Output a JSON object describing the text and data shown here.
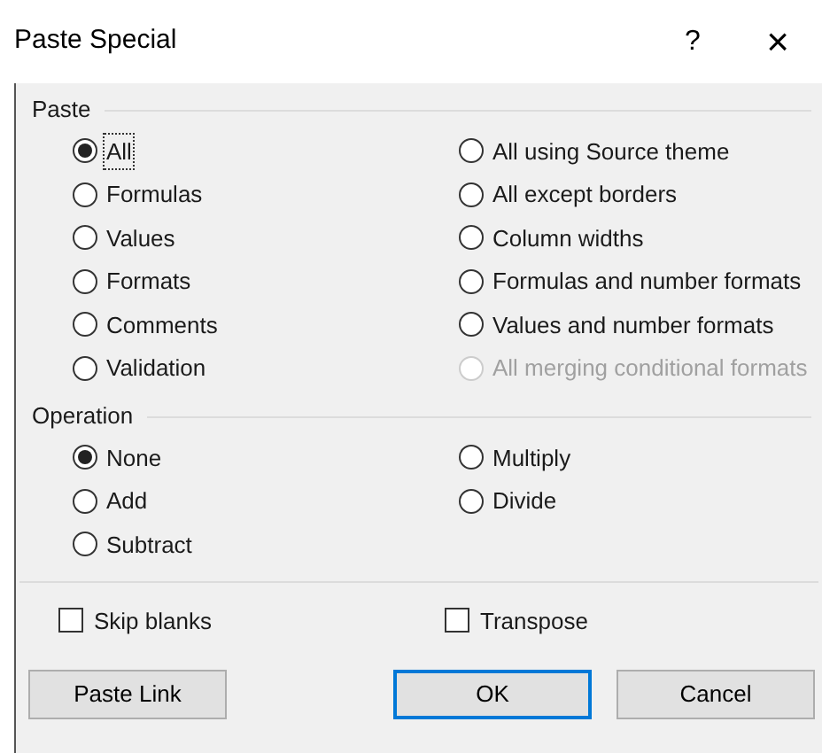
{
  "window": {
    "title": "Paste Special",
    "help": "?",
    "close": "×"
  },
  "paste": {
    "label": "Paste",
    "columns": [
      [
        {
          "label": "All",
          "selected": true,
          "disabled": false,
          "focused": true
        },
        {
          "label": "Formulas",
          "selected": false,
          "disabled": false,
          "focused": false
        },
        {
          "label": "Values",
          "selected": false,
          "disabled": false,
          "focused": false
        },
        {
          "label": "Formats",
          "selected": false,
          "disabled": false,
          "focused": false
        },
        {
          "label": "Comments",
          "selected": false,
          "disabled": false,
          "focused": false
        },
        {
          "label": "Validation",
          "selected": false,
          "disabled": false,
          "focused": false
        }
      ],
      [
        {
          "label": "All using Source theme",
          "selected": false,
          "disabled": false,
          "focused": false
        },
        {
          "label": "All except borders",
          "selected": false,
          "disabled": false,
          "focused": false
        },
        {
          "label": "Column widths",
          "selected": false,
          "disabled": false,
          "focused": false
        },
        {
          "label": "Formulas and number formats",
          "selected": false,
          "disabled": false,
          "focused": false
        },
        {
          "label": "Values and number formats",
          "selected": false,
          "disabled": false,
          "focused": false
        },
        {
          "label": "All merging conditional formats",
          "selected": false,
          "disabled": true,
          "focused": false
        }
      ]
    ]
  },
  "operation": {
    "label": "Operation",
    "columns": [
      [
        {
          "label": "None",
          "selected": true,
          "disabled": false,
          "focused": false
        },
        {
          "label": "Add",
          "selected": false,
          "disabled": false,
          "focused": false
        },
        {
          "label": "Subtract",
          "selected": false,
          "disabled": false,
          "focused": false
        }
      ],
      [
        {
          "label": "Multiply",
          "selected": false,
          "disabled": false,
          "focused": false
        },
        {
          "label": "Divide",
          "selected": false,
          "disabled": false,
          "focused": false
        }
      ]
    ]
  },
  "checkboxes": [
    {
      "label": "Skip blanks",
      "checked": false
    },
    {
      "label": "Transpose",
      "checked": false
    }
  ],
  "buttons": [
    {
      "label": "Paste Link",
      "default": false
    },
    {
      "label": "OK",
      "default": true
    },
    {
      "label": "Cancel",
      "default": false
    }
  ]
}
